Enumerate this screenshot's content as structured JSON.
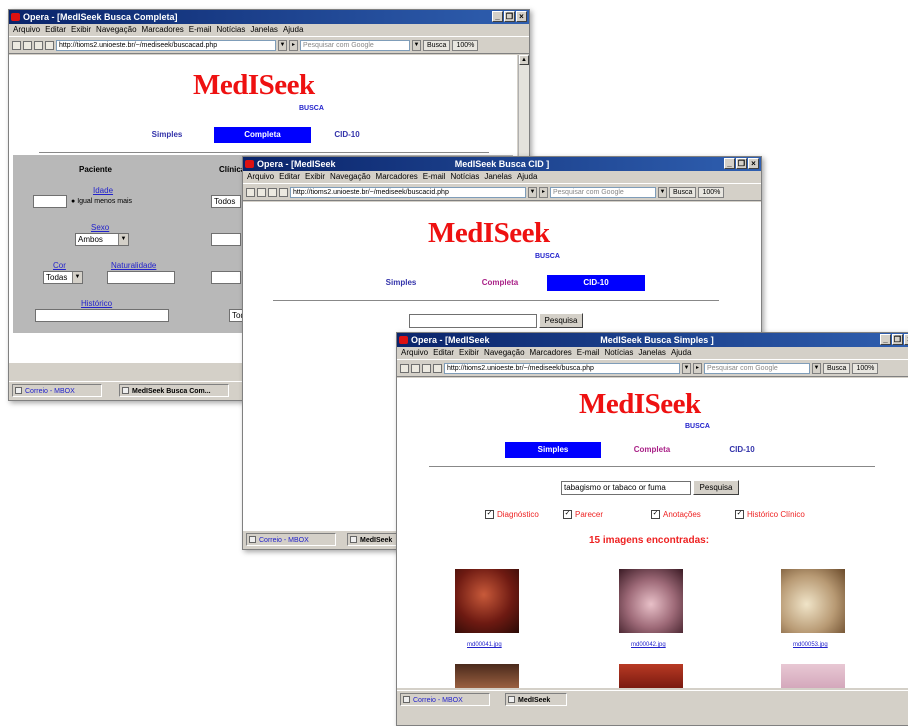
{
  "common": {
    "brand": "MedISeek",
    "busca": "BUSCA",
    "tabs": {
      "simples": "Simples",
      "completa": "Completa",
      "cid": "CID-10"
    },
    "menu": [
      "Arquivo",
      "Editar",
      "Exibir",
      "Navegação",
      "Marcadores",
      "E-mail",
      "Notícias",
      "Janelas",
      "Ajuda"
    ],
    "search_placeholder": "Pesquisar com Google",
    "busca_button": "Busca",
    "zoom": "100%",
    "status_link": "Correio - MBOX"
  },
  "window1": {
    "title": "Opera - [MedISeek Busca Completa]",
    "address": "http://tioms2.unioeste.br/~/mediseek/buscacad.php",
    "task_tab": "MedISeek Busca Com...",
    "form": {
      "paciente_head": "Paciente",
      "clinica_head": "Clínica",
      "idade_label": "Idade",
      "radio_text": "Igual  menos  mais",
      "sexo_label": "Sexo",
      "sexo_value": "Ambos",
      "cor_label": "Cor",
      "cor_value": "Todas",
      "naturalidade_label": "Naturalidade",
      "historico_label": "Histórico",
      "todos_value": "Todos",
      "todos_value2": "Tod"
    }
  },
  "window2": {
    "title": "Opera - [MedISeek",
    "center_title": "MedISeek Busca CID ]",
    "address": "http://tioms2.unioeste.br/~/mediseek/buscacid.php",
    "task_tab": "MedISeek",
    "pesquisa_button": "Pesquisa"
  },
  "window3": {
    "title": "Opera - [MedISeek",
    "center_title": "MedISeek Busca Simples ]",
    "address": "http://tioms2.unioeste.br/~/mediseek/busca.php",
    "task_tab": "MedISeek",
    "search_value": "tabagismo or tabaco or fuma",
    "pesquisa_button": "Pesquisa",
    "checkboxes": [
      "Diagnóstico",
      "Parecer",
      "Anotações",
      "Histórico Clínico"
    ],
    "results_text": "15 imagens encontradas:",
    "thumbs": [
      {
        "caption": "md00041.jpg",
        "color": "#8a2a1c"
      },
      {
        "caption": "md00042.jpg",
        "color": "#9e6a78"
      },
      {
        "caption": "md00053.jpg",
        "color": "#b89a74"
      }
    ]
  }
}
